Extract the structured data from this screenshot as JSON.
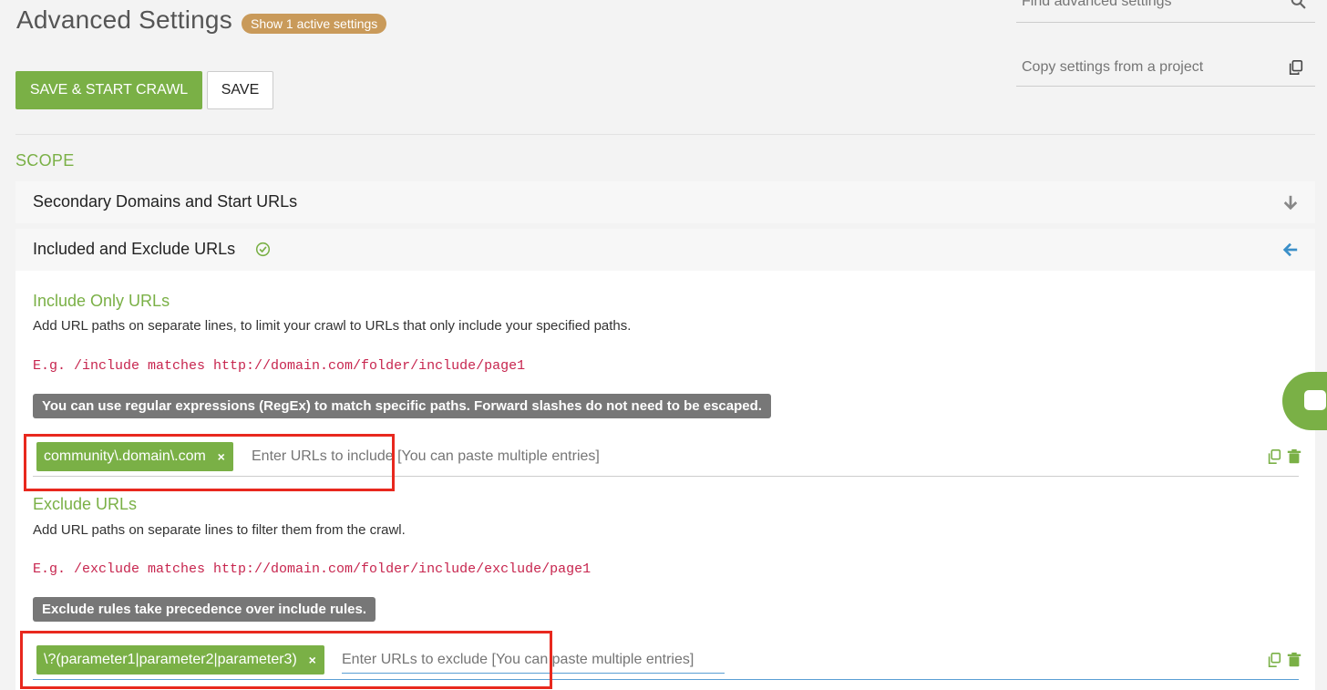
{
  "header": {
    "title": "Advanced Settings",
    "active_badge": "Show 1 active settings",
    "save_start_label": "SAVE & START CRAWL",
    "save_label": "SAVE",
    "search_placeholder": "Find advanced settings",
    "copy_placeholder": "Copy settings from a project"
  },
  "scope": {
    "heading": "SCOPE",
    "rows": [
      {
        "label": "Secondary Domains and Start URLs",
        "state": "collapsed"
      },
      {
        "label": "Included and Exclude URLs",
        "state": "expanded",
        "active": true
      }
    ]
  },
  "include": {
    "title": "Include Only URLs",
    "description": "Add URL paths on separate lines, to limit your crawl to URLs that only include your specified paths.",
    "example": "E.g. /include matches http://domain.com/folder/include/page1",
    "note": "You can use regular expressions (RegEx) to match specific paths. Forward slashes do not need to be escaped.",
    "tags": [
      "community\\.domain\\.com"
    ],
    "placeholder": "Enter URLs to include [You can paste multiple entries]"
  },
  "exclude": {
    "title": "Exclude URLs",
    "description": "Add URL paths on separate lines to filter them from the crawl.",
    "example": "E.g. /exclude matches http://domain.com/folder/include/exclude/page1",
    "note": "Exclude rules take precedence over include rules.",
    "tags": [
      "\\?(parameter1|parameter2|parameter3)"
    ],
    "placeholder": "Enter URLs to exclude [You can paste multiple entries]"
  },
  "tag_remove_symbol": "×",
  "colors": {
    "accent_green": "#7ab046",
    "badge_orange": "#c99a5a",
    "code_red": "#c7254e",
    "note_gray": "#777777",
    "highlight_red": "#e8281e",
    "arrow_blue": "#3a8fc8"
  },
  "icons": [
    "search-icon",
    "copy-icon",
    "arrow-down-icon",
    "arrow-left-icon",
    "check-circle-icon",
    "copy-icon",
    "trash-icon",
    "chat-icon"
  ]
}
